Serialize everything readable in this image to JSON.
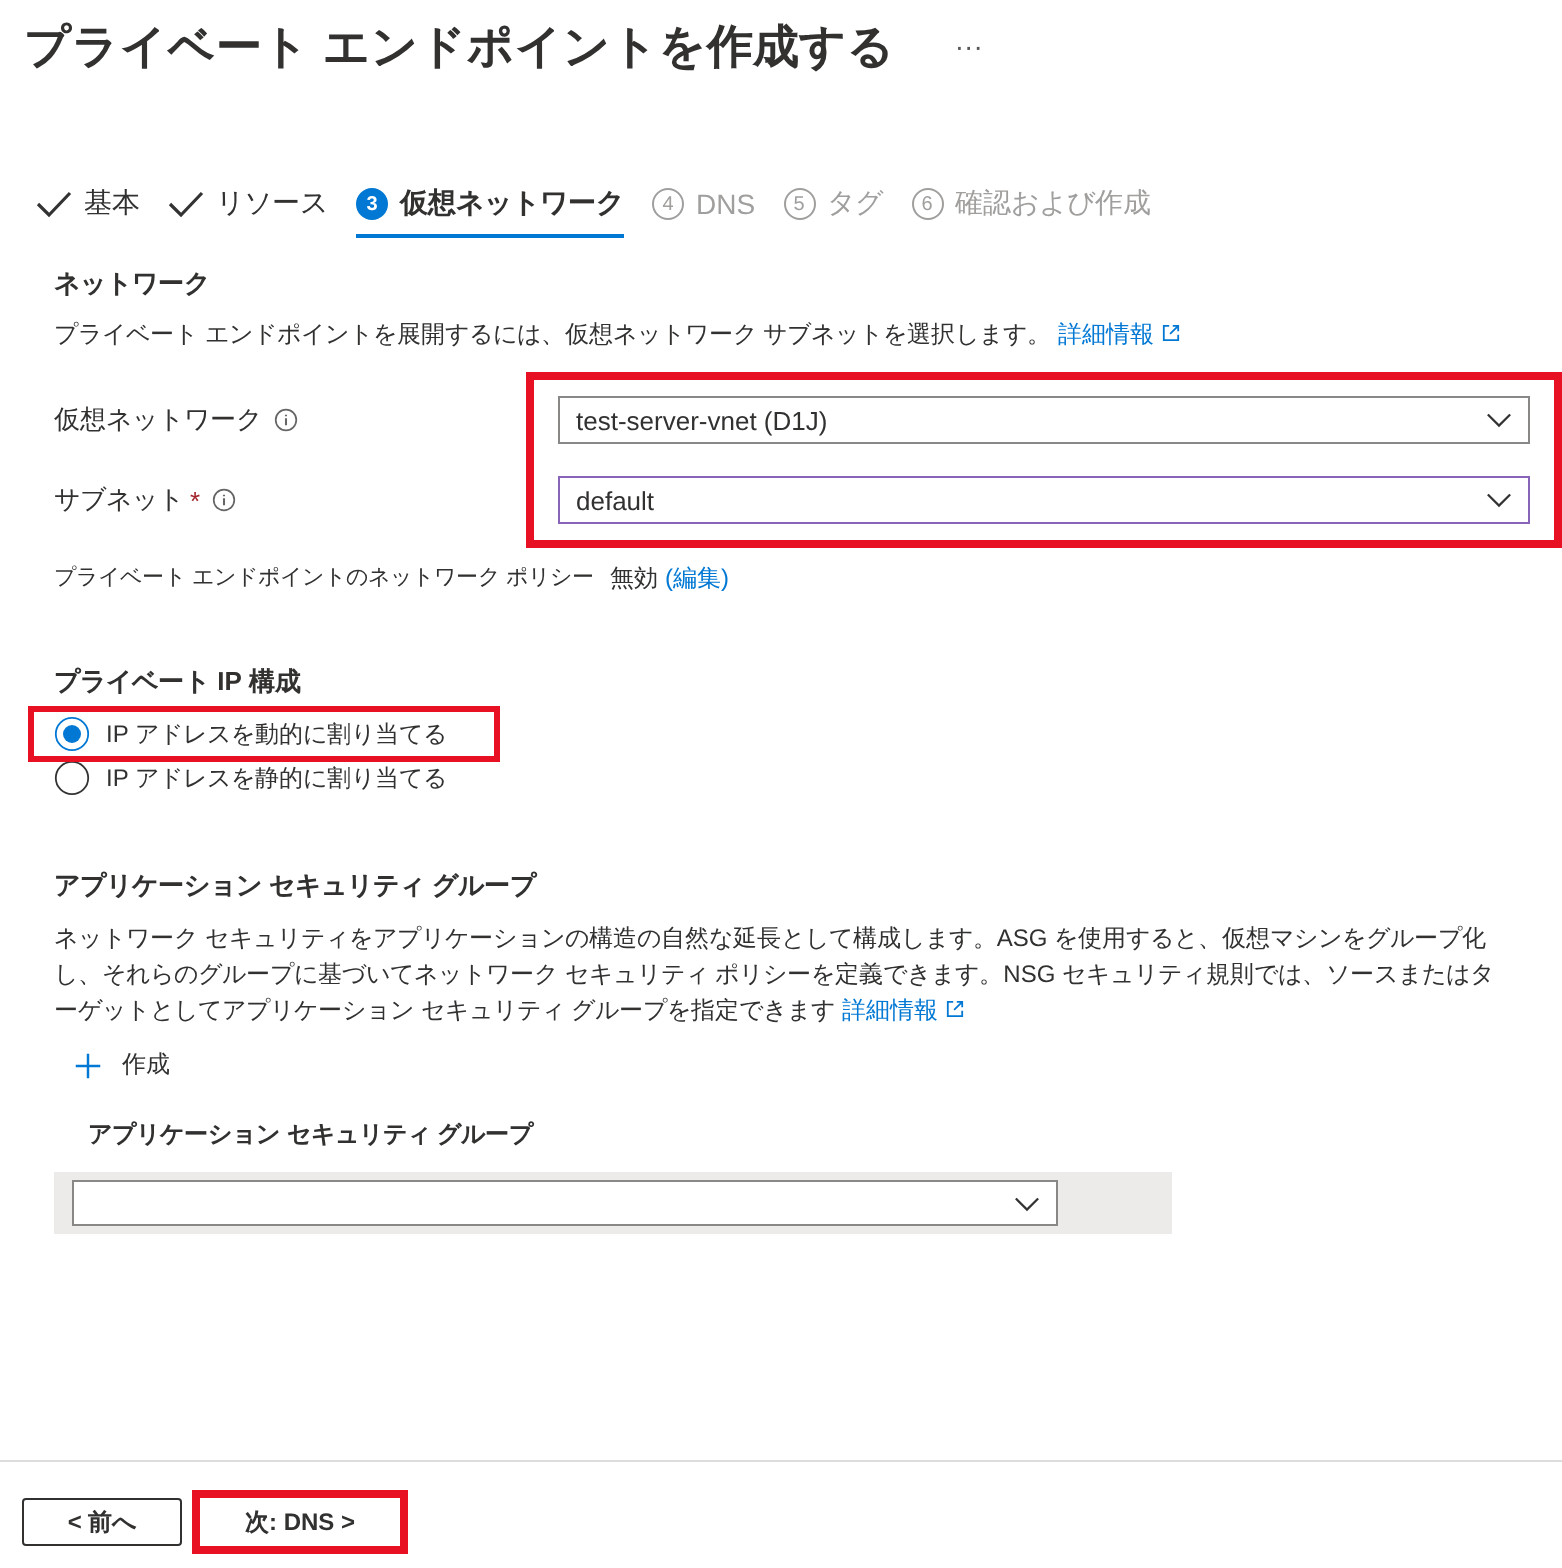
{
  "title": "プライベート エンドポイントを作成する",
  "more": "···",
  "tabs": [
    {
      "kind": "done",
      "label": "基本",
      "selected": false,
      "disabled": false
    },
    {
      "kind": "done",
      "label": "リソース",
      "selected": false,
      "disabled": false
    },
    {
      "kind": "numbered",
      "number": "3",
      "label": "仮想ネットワーク",
      "selected": true,
      "disabled": false
    },
    {
      "kind": "numbered",
      "number": "4",
      "label": "DNS",
      "selected": false,
      "disabled": true
    },
    {
      "kind": "numbered",
      "number": "5",
      "label": "タグ",
      "selected": false,
      "disabled": true
    },
    {
      "kind": "numbered",
      "number": "6",
      "label": "確認および作成",
      "selected": false,
      "disabled": true
    }
  ],
  "network": {
    "heading": "ネットワーク",
    "description": "プライベート エンドポイントを展開するには、仮想ネットワーク サブネットを選択します。",
    "learn_more": "詳細情報",
    "fields_highlighted": true,
    "required_marker": "*",
    "fields": [
      {
        "label": "仮想ネットワーク",
        "required": false,
        "value": "test-server-vnet (D1J)",
        "focused": false
      },
      {
        "label": "サブネット",
        "required": true,
        "value": "default",
        "focused": true
      }
    ],
    "policy": {
      "label": "プライベート エンドポイントのネットワーク ポリシー",
      "value": "無効",
      "edit": "(編集)"
    }
  },
  "ip_config": {
    "heading": "プライベート IP 構成",
    "options": [
      {
        "label": "IP アドレスを動的に割り当てる",
        "selected": true,
        "highlighted": true
      },
      {
        "label": "IP アドレスを静的に割り当てる",
        "selected": false,
        "highlighted": false
      }
    ]
  },
  "asg": {
    "heading": "アプリケーション セキュリティ グループ",
    "description": "ネットワーク セキュリティをアプリケーションの構造の自然な延長として構成します。ASG を使用すると、仮想マシンをグループ化し、それらのグループに基づいてネットワーク セキュリティ ポリシーを定義できます。NSG セキュリティ規則では、ソースまたはターゲットとしてアプリケーション セキュリティ グループを指定できます",
    "learn_more": "詳細情報",
    "create": "作成",
    "column": "アプリケーション セキュリティ グループ"
  },
  "footer": [
    {
      "kind": "previous",
      "label": "< 前へ",
      "highlighted": false
    },
    {
      "kind": "next",
      "label": "次: DNS >",
      "highlighted": true
    }
  ]
}
